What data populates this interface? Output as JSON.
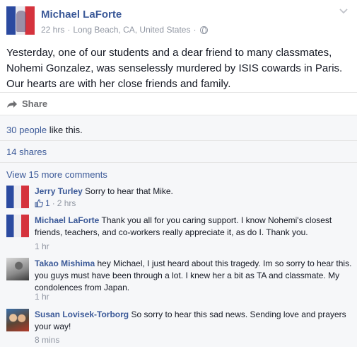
{
  "post": {
    "author": "Michael LaForte",
    "time": "22 hrs",
    "location": "Long Beach, CA, United States",
    "separator": "·",
    "text": "Yesterday, one of our students and a dear friend to many classmates, Nohemi Gonzalez, was senselessly murdered by ISIS cowards in Paris. Our hearts are with her close friends and family.",
    "share_label": "Share"
  },
  "stats": {
    "likes_link": "30 people",
    "likes_suffix": " like this.",
    "shares": "14 shares",
    "more_comments": "View 15 more comments"
  },
  "comments": [
    {
      "name": "Jerry Turley",
      "text": "Sorry to hear that Mike.",
      "likes": "1",
      "time": "2 hrs",
      "sep": "·"
    },
    {
      "name": "Michael LaForte",
      "text": "Thank you all for you caring support. I know Nohemi's closest friends, teachers, and co-workers really appreciate it, as do I. Thank you.",
      "time": "1 hr"
    },
    {
      "name": "Takao Mishima",
      "text": "hey Michael, I just heard about this tragedy. Im so sorry to hear this. you guys must have been through a lot. I knew her a bit as TA and classmate. My condolences from Japan.",
      "time": "1 hr"
    },
    {
      "name": "Susan Lovisek-Torborg",
      "text": "So sorry to hear this sad news. Sending love and prayers your way!",
      "time": "8 mins"
    }
  ],
  "icons": {
    "globe": "globe-icon",
    "share": "share-arrow-icon",
    "like": "thumbs-up-icon",
    "menu": "chevron-down-icon"
  },
  "colors": {
    "link": "#3b5998",
    "meta": "#9197a3",
    "background_comments": "#f6f7f9"
  }
}
